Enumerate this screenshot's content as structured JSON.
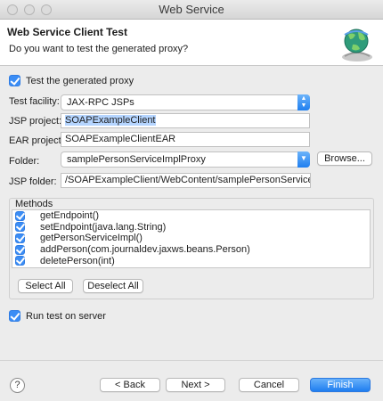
{
  "window": {
    "title": "Web Service"
  },
  "header": {
    "title": "Web Service Client Test",
    "subtitle": "Do you want to test the generated proxy?",
    "icon": "web-service-globe-icon"
  },
  "test_proxy": {
    "label": "Test the generated proxy",
    "checked": true
  },
  "form": {
    "test_facility": {
      "label": "Test facility:",
      "value": "JAX-RPC JSPs"
    },
    "jsp_project": {
      "label": "JSP project:",
      "value": "SOAPExampleClient"
    },
    "ear_project": {
      "label": "EAR project:",
      "value": "SOAPExampleClientEAR"
    },
    "folder": {
      "label": "Folder:",
      "value": "samplePersonServiceImplProxy",
      "browse_label": "Browse..."
    },
    "jsp_folder": {
      "label": "JSP folder:",
      "value": "/SOAPExampleClient/WebContent/samplePersonServiceImplPro"
    }
  },
  "methods": {
    "title": "Methods",
    "items": [
      {
        "label": "getEndpoint()",
        "checked": true
      },
      {
        "label": "setEndpoint(java.lang.String)",
        "checked": true
      },
      {
        "label": "getPersonServiceImpl()",
        "checked": true
      },
      {
        "label": "addPerson(com.journaldev.jaxws.beans.Person)",
        "checked": true
      },
      {
        "label": "deletePerson(int)",
        "checked": true
      }
    ],
    "select_all": "Select All",
    "deselect_all": "Deselect All"
  },
  "run_on_server": {
    "label": "Run test on server",
    "checked": true
  },
  "footer": {
    "help": "?",
    "back": "< Back",
    "next": "Next >",
    "cancel": "Cancel",
    "finish": "Finish"
  },
  "colors": {
    "accent": "#3b8df5",
    "header_bg": "#ffffff",
    "dialog_bg": "#ececec"
  }
}
